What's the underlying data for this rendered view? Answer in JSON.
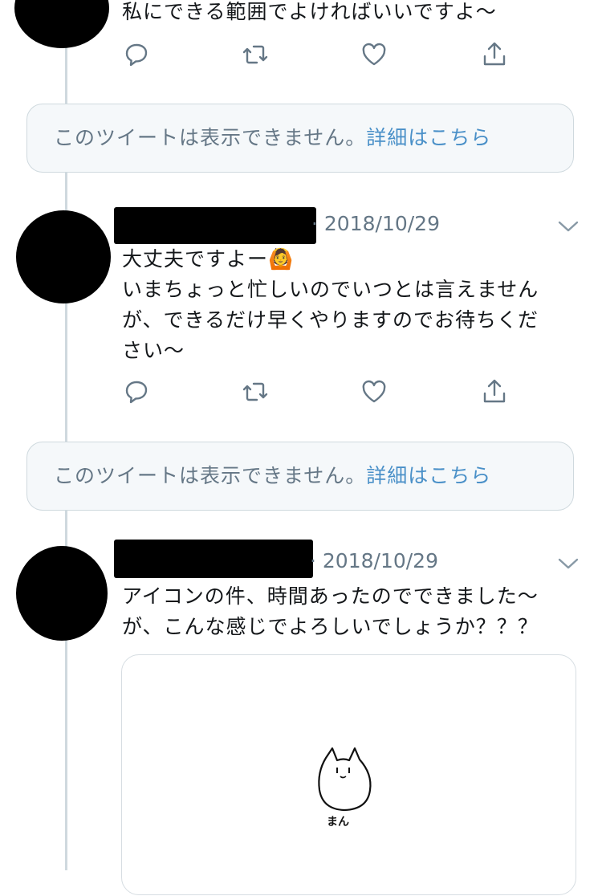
{
  "tweets": [
    {
      "text": "私にできる範囲でよければいいですよ〜"
    },
    {
      "date": "· 2018/10/29",
      "text": "大丈夫ですよー🙆\nいまちょっと忙しいのでいつとは言えません\nが、できるだけ早くやりますのでお待ちくだ\nさい〜"
    },
    {
      "date": "· 2018/10/29",
      "text": "アイコンの件、時間あったのでできました〜\nが、こんな感じでよろしいでしょうか？？？",
      "media_caption": "まん"
    }
  ],
  "notice": {
    "text": "このツイートは表示できません。",
    "link": "詳細はこちら"
  },
  "icons": [
    "reply-icon",
    "retweet-icon",
    "like-icon",
    "share-icon",
    "chevron-down-icon"
  ]
}
